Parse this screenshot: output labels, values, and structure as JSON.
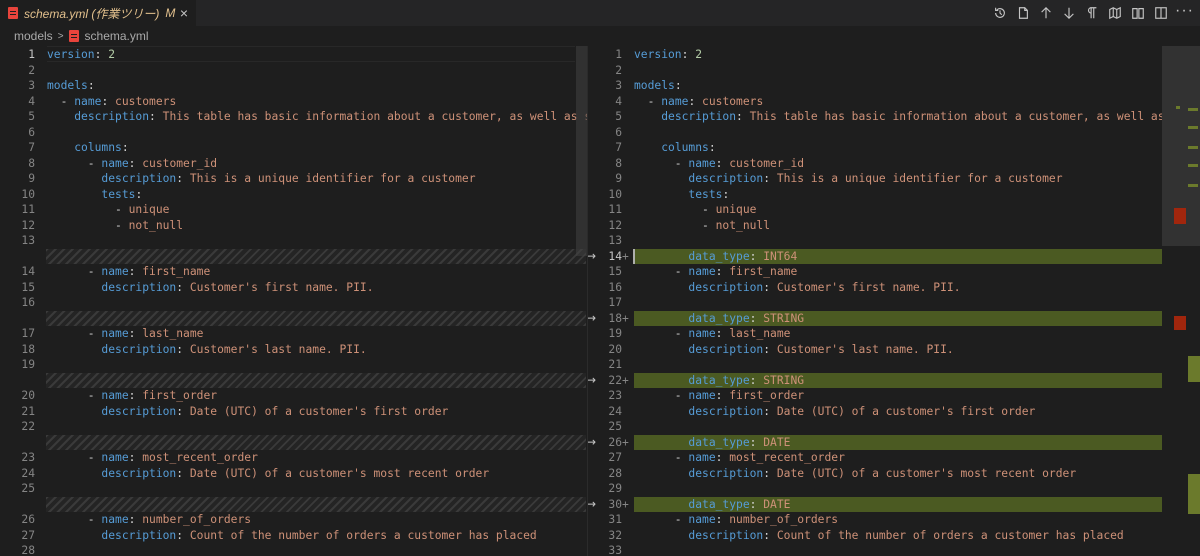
{
  "tab": {
    "title": "schema.yml (作業ツリー)",
    "badge": "M",
    "close": "×"
  },
  "actions": [
    "history-icon",
    "open-file-icon",
    "arrow-up-icon",
    "arrow-down-icon",
    "pilcrow-icon",
    "map-icon",
    "book-icon",
    "split-editor-icon",
    "more-icon"
  ],
  "more": "···",
  "breadcrumb": {
    "folder": "models",
    "separator": ">",
    "file": "schema.yml"
  },
  "left": {
    "lines": [
      {
        "n": "1",
        "active": true,
        "segs": [
          [
            "k",
            "version"
          ],
          [
            "p",
            ": "
          ],
          [
            "n",
            "2"
          ]
        ]
      },
      {
        "n": "2",
        "segs": []
      },
      {
        "n": "3",
        "segs": [
          [
            "k",
            "models"
          ],
          [
            "p",
            ":"
          ]
        ]
      },
      {
        "n": "4",
        "segs": [
          [
            "p",
            "  - "
          ],
          [
            "k",
            "name"
          ],
          [
            "p",
            ": "
          ],
          [
            "s",
            "customers"
          ]
        ]
      },
      {
        "n": "5",
        "segs": [
          [
            "p",
            "    "
          ],
          [
            "k",
            "description"
          ],
          [
            "p",
            ": "
          ],
          [
            "s",
            "This table has basic information about a customer, as well as some der"
          ]
        ]
      },
      {
        "n": "6",
        "segs": []
      },
      {
        "n": "7",
        "segs": [
          [
            "p",
            "    "
          ],
          [
            "k",
            "columns"
          ],
          [
            "p",
            ":"
          ]
        ]
      },
      {
        "n": "8",
        "segs": [
          [
            "p",
            "      - "
          ],
          [
            "k",
            "name"
          ],
          [
            "p",
            ": "
          ],
          [
            "s",
            "customer_id"
          ]
        ]
      },
      {
        "n": "9",
        "segs": [
          [
            "p",
            "        "
          ],
          [
            "k",
            "description"
          ],
          [
            "p",
            ": "
          ],
          [
            "s",
            "This is a unique identifier for a customer"
          ]
        ]
      },
      {
        "n": "10",
        "segs": [
          [
            "p",
            "        "
          ],
          [
            "k",
            "tests"
          ],
          [
            "p",
            ":"
          ]
        ]
      },
      {
        "n": "11",
        "segs": [
          [
            "p",
            "          - "
          ],
          [
            "s",
            "unique"
          ]
        ]
      },
      {
        "n": "12",
        "segs": [
          [
            "p",
            "          - "
          ],
          [
            "s",
            "not_null"
          ]
        ]
      },
      {
        "n": "13",
        "segs": []
      },
      {
        "hatch": true
      },
      {
        "n": "14",
        "segs": [
          [
            "p",
            "      - "
          ],
          [
            "k",
            "name"
          ],
          [
            "p",
            ": "
          ],
          [
            "s",
            "first_name"
          ]
        ]
      },
      {
        "n": "15",
        "segs": [
          [
            "p",
            "        "
          ],
          [
            "k",
            "description"
          ],
          [
            "p",
            ": "
          ],
          [
            "s",
            "Customer's first name. PII."
          ]
        ]
      },
      {
        "n": "16",
        "segs": []
      },
      {
        "hatch": true
      },
      {
        "n": "17",
        "segs": [
          [
            "p",
            "      - "
          ],
          [
            "k",
            "name"
          ],
          [
            "p",
            ": "
          ],
          [
            "s",
            "last_name"
          ]
        ]
      },
      {
        "n": "18",
        "segs": [
          [
            "p",
            "        "
          ],
          [
            "k",
            "description"
          ],
          [
            "p",
            ": "
          ],
          [
            "s",
            "Customer's last name. PII."
          ]
        ]
      },
      {
        "n": "19",
        "segs": []
      },
      {
        "hatch": true
      },
      {
        "n": "20",
        "segs": [
          [
            "p",
            "      - "
          ],
          [
            "k",
            "name"
          ],
          [
            "p",
            ": "
          ],
          [
            "s",
            "first_order"
          ]
        ]
      },
      {
        "n": "21",
        "segs": [
          [
            "p",
            "        "
          ],
          [
            "k",
            "description"
          ],
          [
            "p",
            ": "
          ],
          [
            "s",
            "Date (UTC) of a customer's first order"
          ]
        ]
      },
      {
        "n": "22",
        "segs": []
      },
      {
        "hatch": true
      },
      {
        "n": "23",
        "segs": [
          [
            "p",
            "      - "
          ],
          [
            "k",
            "name"
          ],
          [
            "p",
            ": "
          ],
          [
            "s",
            "most_recent_order"
          ]
        ]
      },
      {
        "n": "24",
        "segs": [
          [
            "p",
            "        "
          ],
          [
            "k",
            "description"
          ],
          [
            "p",
            ": "
          ],
          [
            "s",
            "Date (UTC) of a customer's most recent order"
          ]
        ]
      },
      {
        "n": "25",
        "segs": []
      },
      {
        "hatch": true
      },
      {
        "n": "26",
        "segs": [
          [
            "p",
            "      - "
          ],
          [
            "k",
            "name"
          ],
          [
            "p",
            ": "
          ],
          [
            "s",
            "number_of_orders"
          ]
        ]
      },
      {
        "n": "27",
        "segs": [
          [
            "p",
            "        "
          ],
          [
            "k",
            "description"
          ],
          [
            "p",
            ": "
          ],
          [
            "s",
            "Count of the number of orders a customer has placed"
          ]
        ]
      },
      {
        "n": "28",
        "segs": []
      }
    ]
  },
  "right": {
    "lines": [
      {
        "n": "1",
        "segs": [
          [
            "k",
            "version"
          ],
          [
            "p",
            ": "
          ],
          [
            "n",
            "2"
          ]
        ]
      },
      {
        "n": "2",
        "segs": []
      },
      {
        "n": "3",
        "segs": [
          [
            "k",
            "models"
          ],
          [
            "p",
            ":"
          ]
        ]
      },
      {
        "n": "4",
        "segs": [
          [
            "p",
            "  - "
          ],
          [
            "k",
            "name"
          ],
          [
            "p",
            ": "
          ],
          [
            "s",
            "customers"
          ]
        ]
      },
      {
        "n": "5",
        "segs": [
          [
            "p",
            "    "
          ],
          [
            "k",
            "description"
          ],
          [
            "p",
            ": "
          ],
          [
            "s",
            "This table has basic information about a customer, as well as some der"
          ]
        ]
      },
      {
        "n": "6",
        "segs": []
      },
      {
        "n": "7",
        "segs": [
          [
            "p",
            "    "
          ],
          [
            "k",
            "columns"
          ],
          [
            "p",
            ":"
          ]
        ]
      },
      {
        "n": "8",
        "segs": [
          [
            "p",
            "      - "
          ],
          [
            "k",
            "name"
          ],
          [
            "p",
            ": "
          ],
          [
            "s",
            "customer_id"
          ]
        ]
      },
      {
        "n": "9",
        "segs": [
          [
            "p",
            "        "
          ],
          [
            "k",
            "description"
          ],
          [
            "p",
            ": "
          ],
          [
            "s",
            "This is a unique identifier for a customer"
          ]
        ]
      },
      {
        "n": "10",
        "segs": [
          [
            "p",
            "        "
          ],
          [
            "k",
            "tests"
          ],
          [
            "p",
            ":"
          ]
        ]
      },
      {
        "n": "11",
        "segs": [
          [
            "p",
            "          - "
          ],
          [
            "s",
            "unique"
          ]
        ]
      },
      {
        "n": "12",
        "segs": [
          [
            "p",
            "          - "
          ],
          [
            "s",
            "not_null"
          ]
        ]
      },
      {
        "n": "13",
        "segs": []
      },
      {
        "n": "14",
        "added": true,
        "active": true,
        "cursor": true,
        "segs": [
          [
            "p",
            "        "
          ],
          [
            "k",
            "data_type"
          ],
          [
            "p",
            ": "
          ],
          [
            "s",
            "INT64"
          ]
        ]
      },
      {
        "n": "15",
        "segs": [
          [
            "p",
            "      - "
          ],
          [
            "k",
            "name"
          ],
          [
            "p",
            ": "
          ],
          [
            "s",
            "first_name"
          ]
        ]
      },
      {
        "n": "16",
        "segs": [
          [
            "p",
            "        "
          ],
          [
            "k",
            "description"
          ],
          [
            "p",
            ": "
          ],
          [
            "s",
            "Customer's first name. PII."
          ]
        ]
      },
      {
        "n": "17",
        "segs": []
      },
      {
        "n": "18",
        "added": true,
        "segs": [
          [
            "p",
            "        "
          ],
          [
            "k",
            "data_type"
          ],
          [
            "p",
            ": "
          ],
          [
            "s",
            "STRING"
          ]
        ]
      },
      {
        "n": "19",
        "segs": [
          [
            "p",
            "      - "
          ],
          [
            "k",
            "name"
          ],
          [
            "p",
            ": "
          ],
          [
            "s",
            "last_name"
          ]
        ]
      },
      {
        "n": "20",
        "segs": [
          [
            "p",
            "        "
          ],
          [
            "k",
            "description"
          ],
          [
            "p",
            ": "
          ],
          [
            "s",
            "Customer's last name. PII."
          ]
        ]
      },
      {
        "n": "21",
        "segs": []
      },
      {
        "n": "22",
        "added": true,
        "segs": [
          [
            "p",
            "        "
          ],
          [
            "k",
            "data_type"
          ],
          [
            "p",
            ": "
          ],
          [
            "s",
            "STRING"
          ]
        ]
      },
      {
        "n": "23",
        "segs": [
          [
            "p",
            "      - "
          ],
          [
            "k",
            "name"
          ],
          [
            "p",
            ": "
          ],
          [
            "s",
            "first_order"
          ]
        ]
      },
      {
        "n": "24",
        "segs": [
          [
            "p",
            "        "
          ],
          [
            "k",
            "description"
          ],
          [
            "p",
            ": "
          ],
          [
            "s",
            "Date (UTC) of a customer's first order"
          ]
        ]
      },
      {
        "n": "25",
        "segs": []
      },
      {
        "n": "26",
        "added": true,
        "segs": [
          [
            "p",
            "        "
          ],
          [
            "k",
            "data_type"
          ],
          [
            "p",
            ": "
          ],
          [
            "s",
            "DATE"
          ]
        ]
      },
      {
        "n": "27",
        "segs": [
          [
            "p",
            "      - "
          ],
          [
            "k",
            "name"
          ],
          [
            "p",
            ": "
          ],
          [
            "s",
            "most_recent_order"
          ]
        ]
      },
      {
        "n": "28",
        "segs": [
          [
            "p",
            "        "
          ],
          [
            "k",
            "description"
          ],
          [
            "p",
            ": "
          ],
          [
            "s",
            "Date (UTC) of a customer's most recent order"
          ]
        ]
      },
      {
        "n": "29",
        "segs": []
      },
      {
        "n": "30",
        "added": true,
        "segs": [
          [
            "p",
            "        "
          ],
          [
            "k",
            "data_type"
          ],
          [
            "p",
            ": "
          ],
          [
            "s",
            "DATE"
          ]
        ]
      },
      {
        "n": "31",
        "segs": [
          [
            "p",
            "      - "
          ],
          [
            "k",
            "name"
          ],
          [
            "p",
            ": "
          ],
          [
            "s",
            "number_of_orders"
          ]
        ]
      },
      {
        "n": "32",
        "segs": [
          [
            "p",
            "        "
          ],
          [
            "k",
            "description"
          ],
          [
            "p",
            ": "
          ],
          [
            "s",
            "Count of the number of orders a customer has placed"
          ]
        ]
      },
      {
        "n": "33",
        "segs": []
      }
    ]
  },
  "markers": {
    "added_plus": "+",
    "arrow": "→"
  },
  "colors": {
    "keyword": "#569cd6",
    "string": "#ce9178",
    "number": "#b5cea8",
    "added_line": "#4b5a22",
    "deleted_marker": "#a1260d",
    "tab_title": "#e2c08d"
  }
}
